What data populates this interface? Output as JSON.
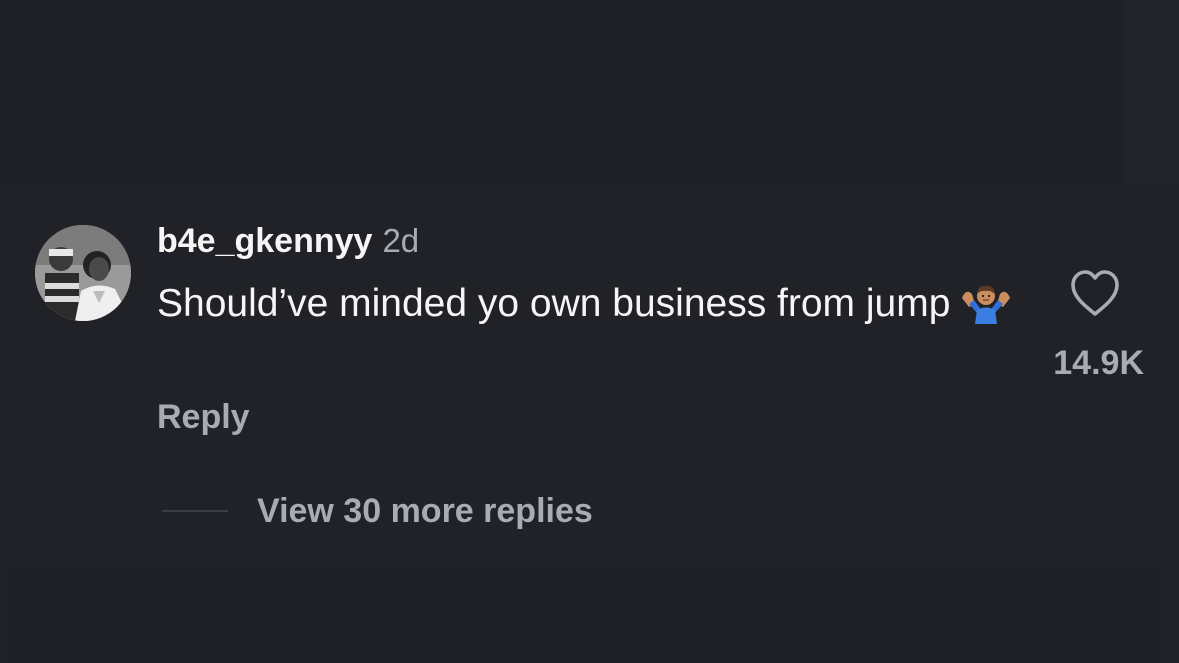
{
  "comment": {
    "username": "b4e_gkenny​y",
    "timestamp": "2d",
    "text": "Should’ve minded yo own business from jump",
    "emoji_name": "person-shrugging-emoji",
    "reply_label": "Reply",
    "like_count": "14.9K",
    "like_icon": "heart-outline-icon"
  },
  "replies": {
    "view_more_label": "View 30 more replies"
  },
  "colors": {
    "background": "#202227",
    "primary_text": "#f5f5f5",
    "secondary_text": "#a8abb2"
  }
}
